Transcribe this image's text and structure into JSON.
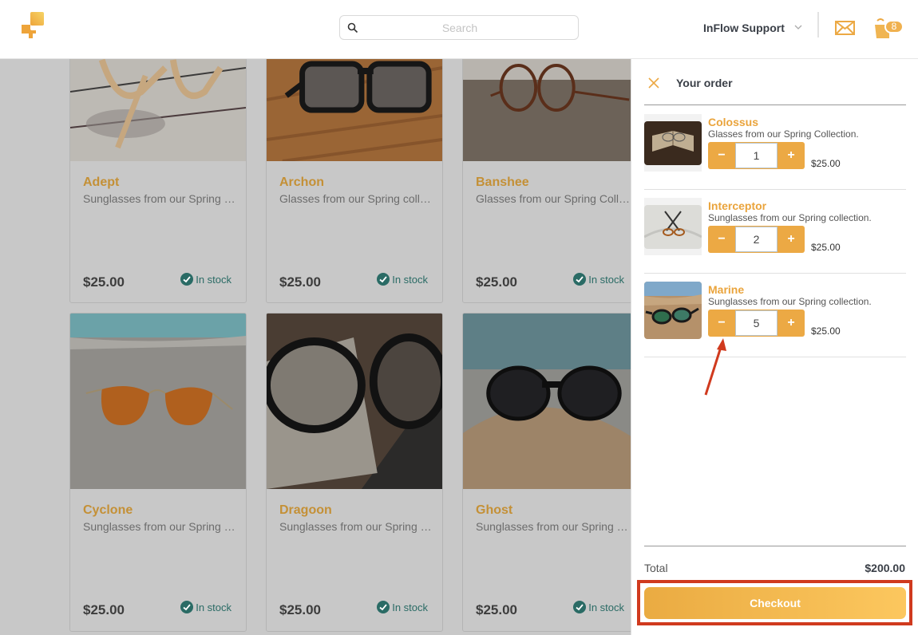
{
  "header": {
    "logo_icon": "puzzle-logo-icon",
    "search": {
      "placeholder": "Search",
      "value": ""
    },
    "user_name": "InFlow Support",
    "mail_icon": "envelope-icon",
    "cart_icon": "shopping-bag-icon",
    "cart_count": "8"
  },
  "products": [
    {
      "name": "Adept",
      "description": "Sunglasses from our Spring collection.",
      "price": "$25.00",
      "stock": "In stock"
    },
    {
      "name": "Archon",
      "description": "Glasses from our Spring collection.",
      "price": "$25.00",
      "stock": "In stock"
    },
    {
      "name": "Banshee",
      "description": "Glasses from our Spring Collection.",
      "price": "$25.00",
      "stock": "In stock"
    },
    {
      "name": "Cyclone",
      "description": "Sunglasses from our Spring collection.",
      "price": "$25.00",
      "stock": "In stock"
    },
    {
      "name": "Dragoon",
      "description": "Sunglasses from our Spring collection.",
      "price": "$25.00",
      "stock": "In stock"
    },
    {
      "name": "Ghost",
      "description": "Sunglasses from our Spring collection.",
      "price": "$25.00",
      "stock": "In stock"
    }
  ],
  "order": {
    "title": "Your order",
    "items": [
      {
        "name": "Colossus",
        "description": "Glasses from our Spring Collection.",
        "quantity": "1",
        "price": "$25.00",
        "minus": "−",
        "plus": "+"
      },
      {
        "name": "Interceptor",
        "description": "Sunglasses from our Spring collection.",
        "quantity": "2",
        "price": "$25.00",
        "minus": "−",
        "plus": "+"
      },
      {
        "name": "Marine",
        "description": "Sunglasses from our Spring collection.",
        "quantity": "5",
        "price": "$25.00",
        "minus": "−",
        "plus": "+"
      }
    ],
    "total_label": "Total",
    "total_value": "$200.00",
    "checkout_label": "Checkout"
  },
  "colors": {
    "accent": "#eca944",
    "product_name": "#c49036",
    "in_stock": "#2a6b65",
    "annotation": "#d03a1e"
  }
}
